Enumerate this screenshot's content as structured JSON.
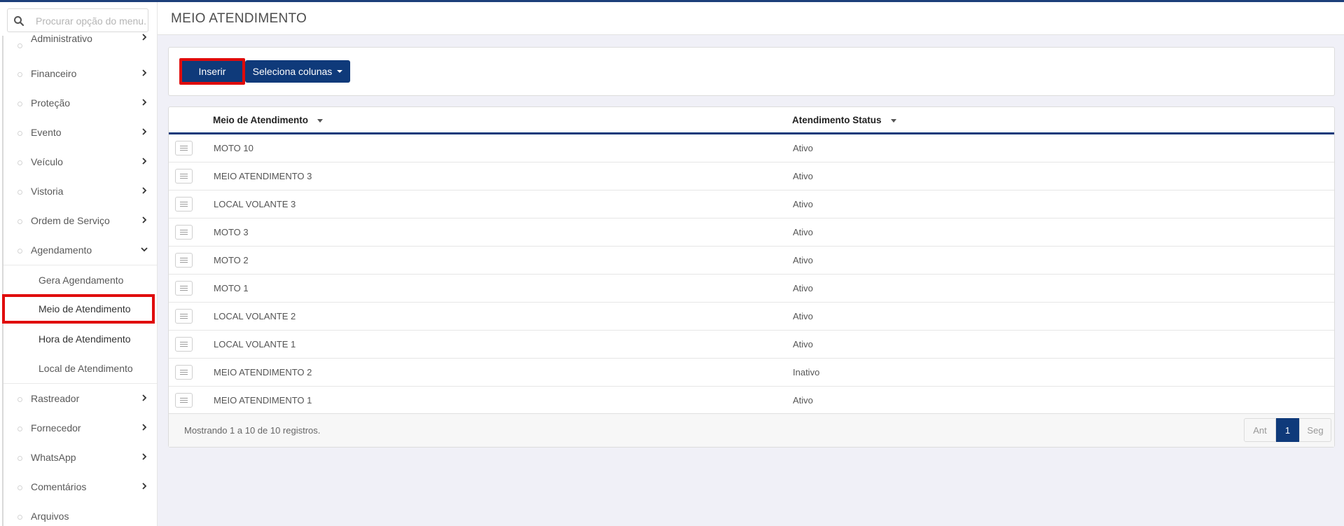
{
  "search": {
    "placeholder": "Procurar opção do menu..."
  },
  "sidebar": {
    "items": [
      {
        "label": "Administrativo"
      },
      {
        "label": "Financeiro"
      },
      {
        "label": "Proteção"
      },
      {
        "label": "Evento"
      },
      {
        "label": "Veículo"
      },
      {
        "label": "Vistoria"
      },
      {
        "label": "Ordem de Serviço"
      },
      {
        "label": "Agendamento"
      }
    ],
    "submenu": [
      {
        "label": "Gera Agendamento"
      },
      {
        "label": "Meio de Atendimento"
      },
      {
        "label": "Hora de Atendimento"
      },
      {
        "label": "Local de Atendimento"
      }
    ],
    "items_after": [
      {
        "label": "Rastreador"
      },
      {
        "label": "Fornecedor"
      },
      {
        "label": "WhatsApp"
      },
      {
        "label": "Comentários"
      },
      {
        "label": "Arquivos"
      }
    ]
  },
  "header": {
    "title": "MEIO ATENDIMENTO"
  },
  "toolbar": {
    "insert_label": "Inserir",
    "columns_label": "Seleciona colunas"
  },
  "table": {
    "columns": [
      "Meio de Atendimento",
      "Atendimento Status"
    ],
    "rows": [
      {
        "meio": "MOTO 10",
        "status": "Ativo"
      },
      {
        "meio": "MEIO ATENDIMENTO 3",
        "status": "Ativo"
      },
      {
        "meio": "LOCAL VOLANTE 3",
        "status": "Ativo"
      },
      {
        "meio": "MOTO 3",
        "status": "Ativo"
      },
      {
        "meio": "MOTO 2",
        "status": "Ativo"
      },
      {
        "meio": "MOTO 1",
        "status": "Ativo"
      },
      {
        "meio": "LOCAL VOLANTE 2",
        "status": "Ativo"
      },
      {
        "meio": "LOCAL VOLANTE 1",
        "status": "Ativo"
      },
      {
        "meio": "MEIO ATENDIMENTO 2",
        "status": "Inativo"
      },
      {
        "meio": "MEIO ATENDIMENTO 1",
        "status": "Ativo"
      }
    ],
    "footer_info": "Mostrando 1 a 10 de 10 registros."
  },
  "pagination": {
    "prev": "Ant",
    "current": "1",
    "next": "Seg"
  },
  "colors": {
    "primary": "#0f3a7a",
    "highlight": "#e00b0b"
  }
}
